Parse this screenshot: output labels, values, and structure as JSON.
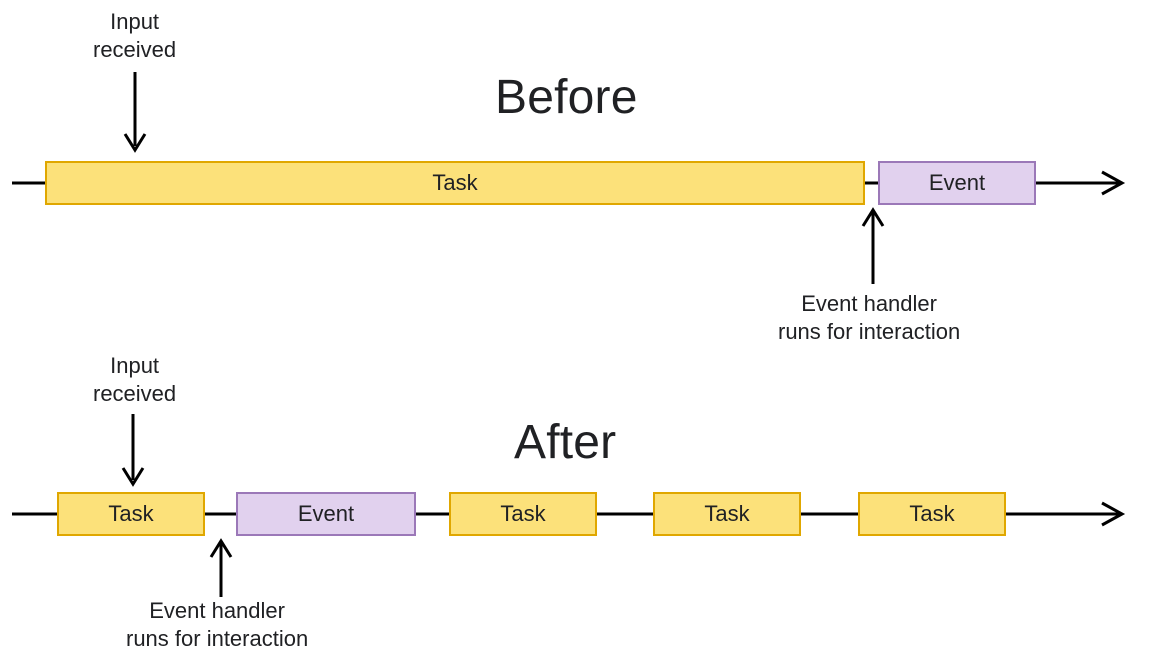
{
  "titles": {
    "before": "Before",
    "after": "After"
  },
  "annotations": {
    "input_received": "Input\nreceived",
    "event_handler": "Event handler\nruns for interaction"
  },
  "labels": {
    "task": "Task",
    "event": "Event"
  },
  "colors": {
    "task_fill": "#fce17a",
    "task_border": "#e0a700",
    "event_fill": "#e1d1ee",
    "event_border": "#9b78b8",
    "arrow": "#000000"
  },
  "chart_data": {
    "type": "timeline-diagram",
    "description": "Two horizontal timelines comparing how user input is handled. 'Before': a single long Task block occupies almost the whole timeline, so the Event (user interaction handler) can only run after it finishes. 'After': the same work is broken into several short Task blocks, allowing the Event to run right after the first Task, much sooner.",
    "timelines": [
      {
        "name": "Before",
        "input_received_after_block_index": 0,
        "input_received_relative_position": 0.12,
        "event_runs_after_block_index": 0,
        "blocks": [
          {
            "kind": "task",
            "label": "Task",
            "relative_width": 0.73
          },
          {
            "kind": "event",
            "label": "Event",
            "relative_width": 0.14
          }
        ]
      },
      {
        "name": "After",
        "input_received_after_block_index": 0,
        "input_received_relative_position": 0.5,
        "event_runs_after_block_index": 0,
        "blocks": [
          {
            "kind": "task",
            "label": "Task",
            "relative_width": 0.14
          },
          {
            "kind": "event",
            "label": "Event",
            "relative_width": 0.16
          },
          {
            "kind": "task",
            "label": "Task",
            "relative_width": 0.14
          },
          {
            "kind": "task",
            "label": "Task",
            "relative_width": 0.14
          },
          {
            "kind": "task",
            "label": "Task",
            "relative_width": 0.14
          }
        ]
      }
    ]
  }
}
